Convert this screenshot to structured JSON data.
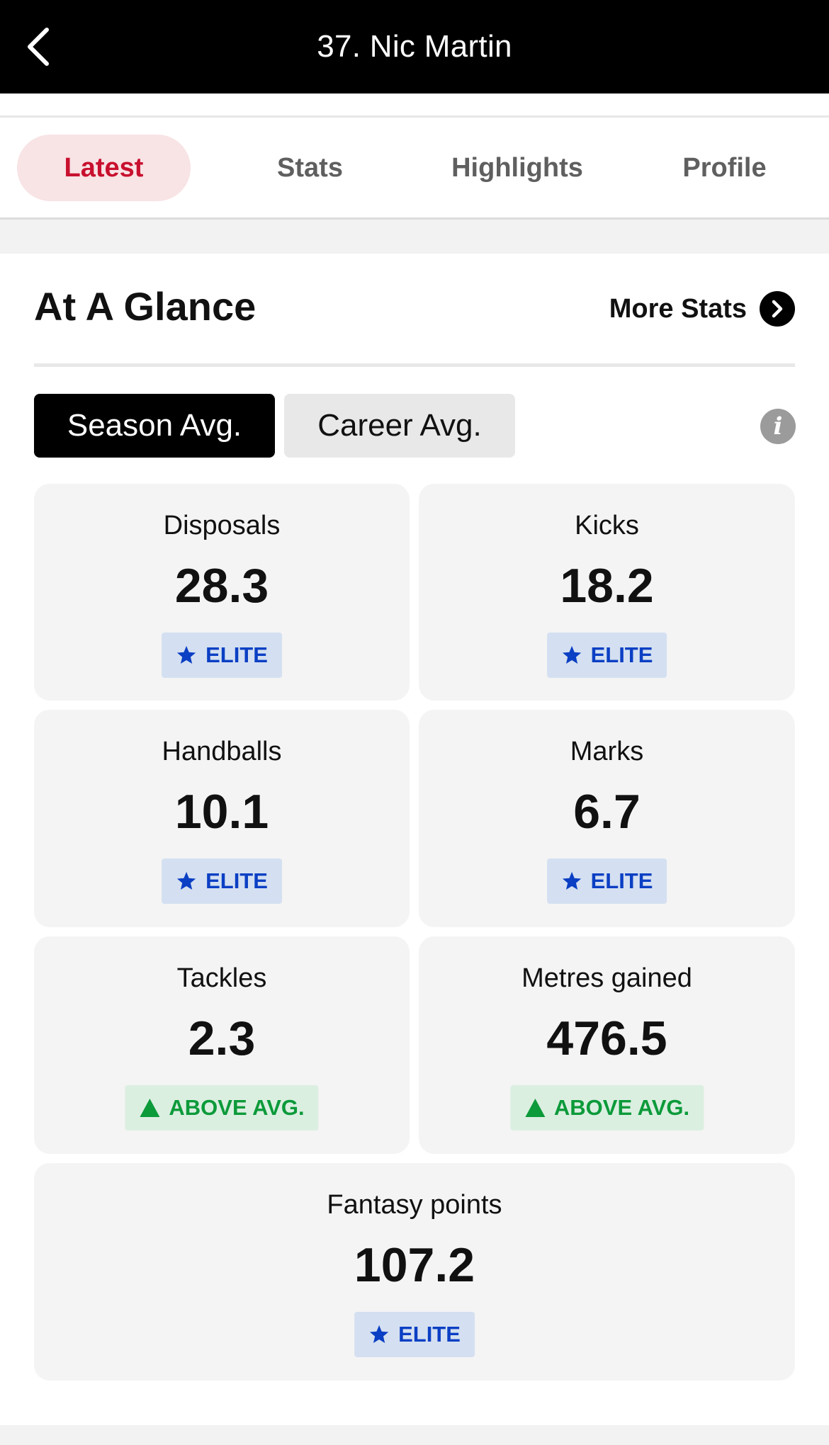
{
  "header": {
    "title": "37. Nic Martin"
  },
  "tabs": [
    {
      "label": "Latest",
      "active": true
    },
    {
      "label": "Stats",
      "active": false
    },
    {
      "label": "Highlights",
      "active": false
    },
    {
      "label": "Profile",
      "active": false
    }
  ],
  "section": {
    "title": "At A Glance",
    "more_stats_label": "More Stats"
  },
  "toggle": {
    "season_label": "Season Avg.",
    "career_label": "Career Avg.",
    "selected": "Season Avg."
  },
  "info_icon_glyph": "i",
  "stats": [
    {
      "label": "Disposals",
      "value": "28.3",
      "badge": "ELITE",
      "badge_type": "elite"
    },
    {
      "label": "Kicks",
      "value": "18.2",
      "badge": "ELITE",
      "badge_type": "elite"
    },
    {
      "label": "Handballs",
      "value": "10.1",
      "badge": "ELITE",
      "badge_type": "elite"
    },
    {
      "label": "Marks",
      "value": "6.7",
      "badge": "ELITE",
      "badge_type": "elite"
    },
    {
      "label": "Tackles",
      "value": "2.3",
      "badge": "ABOVE AVG.",
      "badge_type": "above"
    },
    {
      "label": "Metres gained",
      "value": "476.5",
      "badge": "ABOVE AVG.",
      "badge_type": "above"
    },
    {
      "label": "Fantasy points",
      "value": "107.2",
      "badge": "ELITE",
      "badge_type": "elite"
    }
  ],
  "icons": {
    "back": "chevron-left-icon",
    "more_stats": "chevron-right-circle-icon",
    "info": "info-icon",
    "elite": "star-icon",
    "above": "triangle-up-icon"
  },
  "colors": {
    "header_bg": "#000000",
    "accent_red": "#c8102e",
    "active_tab_bg": "#f8e3e5",
    "elite_text": "#0b3fc4",
    "elite_bg": "#d4e0f1",
    "above_text": "#0c9a3a",
    "above_bg": "#dbefe1",
    "card_bg": "#f4f4f4"
  }
}
